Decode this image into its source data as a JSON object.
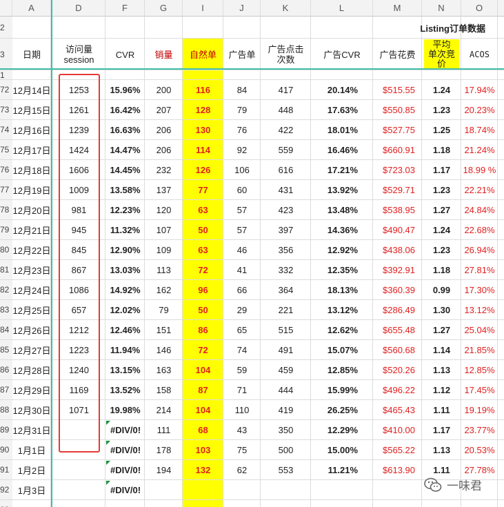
{
  "column_letters": [
    "A",
    "D",
    "F",
    "G",
    "I",
    "J",
    "K",
    "L",
    "M",
    "N",
    "O"
  ],
  "header_row_numbers": {
    "title_row": "2",
    "header_row": "3",
    "partial_top_row": "1"
  },
  "title": "Listing订单数据",
  "headers": {
    "date": "日期",
    "sessions_l1": "访问量",
    "sessions_l2": "session",
    "cvr": "CVR",
    "sales": "销量",
    "organic": "自然单",
    "ad_orders": "广告单",
    "ad_clicks_l1": "广告点击",
    "ad_clicks_l2": "次数",
    "ad_cvr": "广告CVR",
    "ad_spend": "广告花费",
    "avg_bid_l1": "平均",
    "avg_bid_l2": "单次竞",
    "avg_bid_l3": "价",
    "acos": "ACOS"
  },
  "rows": [
    {
      "rn": "72",
      "date": "12月14日",
      "sessions": "1253",
      "cvr": "15.96%",
      "sales": "200",
      "organic": "116",
      "ad_orders": "84",
      "ad_clicks": "417",
      "ad_cvr": "20.14%",
      "ad_spend": "$515.55",
      "avg_bid": "1.24",
      "acos": "17.94%"
    },
    {
      "rn": "73",
      "date": "12月15日",
      "sessions": "1261",
      "cvr": "16.42%",
      "sales": "207",
      "organic": "128",
      "ad_orders": "79",
      "ad_clicks": "448",
      "ad_cvr": "17.63%",
      "ad_spend": "$550.85",
      "avg_bid": "1.23",
      "acos": "20.23%"
    },
    {
      "rn": "74",
      "date": "12月16日",
      "sessions": "1239",
      "cvr": "16.63%",
      "sales": "206",
      "organic": "130",
      "ad_orders": "76",
      "ad_clicks": "422",
      "ad_cvr": "18.01%",
      "ad_spend": "$527.75",
      "avg_bid": "1.25",
      "acos": "18.74%"
    },
    {
      "rn": "75",
      "date": "12月17日",
      "sessions": "1424",
      "cvr": "14.47%",
      "sales": "206",
      "organic": "114",
      "ad_orders": "92",
      "ad_clicks": "559",
      "ad_cvr": "16.46%",
      "ad_spend": "$660.91",
      "avg_bid": "1.18",
      "acos": "21.24%"
    },
    {
      "rn": "76",
      "date": "12月18日",
      "sessions": "1606",
      "cvr": "14.45%",
      "sales": "232",
      "organic": "126",
      "ad_orders": "106",
      "ad_clicks": "616",
      "ad_cvr": "17.21%",
      "ad_spend": "$723.03",
      "avg_bid": "1.17",
      "acos": "18.99 %"
    },
    {
      "rn": "77",
      "date": "12月19日",
      "sessions": "1009",
      "cvr": "13.58%",
      "sales": "137",
      "organic": "77",
      "ad_orders": "60",
      "ad_clicks": "431",
      "ad_cvr": "13.92%",
      "ad_spend": "$529.71",
      "avg_bid": "1.23",
      "acos": "22.21%"
    },
    {
      "rn": "78",
      "date": "12月20日",
      "sessions": "981",
      "cvr": "12.23%",
      "sales": "120",
      "organic": "63",
      "ad_orders": "57",
      "ad_clicks": "423",
      "ad_cvr": "13.48%",
      "ad_spend": "$538.95",
      "avg_bid": "1.27",
      "acos": "24.84%"
    },
    {
      "rn": "79",
      "date": "12月21日",
      "sessions": "945",
      "cvr": "11.32%",
      "sales": "107",
      "organic": "50",
      "ad_orders": "57",
      "ad_clicks": "397",
      "ad_cvr": "14.36%",
      "ad_spend": "$490.47",
      "avg_bid": "1.24",
      "acos": "22.68%"
    },
    {
      "rn": "80",
      "date": "12月22日",
      "sessions": "845",
      "cvr": "12.90%",
      "sales": "109",
      "organic": "63",
      "ad_orders": "46",
      "ad_clicks": "356",
      "ad_cvr": "12.92%",
      "ad_spend": "$438.06",
      "avg_bid": "1.23",
      "acos": "26.94%"
    },
    {
      "rn": "81",
      "date": "12月23日",
      "sessions": "867",
      "cvr": "13.03%",
      "sales": "113",
      "organic": "72",
      "ad_orders": "41",
      "ad_clicks": "332",
      "ad_cvr": "12.35%",
      "ad_spend": "$392.91",
      "avg_bid": "1.18",
      "acos": "27.81%"
    },
    {
      "rn": "82",
      "date": "12月24日",
      "sessions": "1086",
      "cvr": "14.92%",
      "sales": "162",
      "organic": "96",
      "ad_orders": "66",
      "ad_clicks": "364",
      "ad_cvr": "18.13%",
      "ad_spend": "$360.39",
      "avg_bid": "0.99",
      "acos": "17.30%"
    },
    {
      "rn": "83",
      "date": "12月25日",
      "sessions": "657",
      "cvr": "12.02%",
      "sales": "79",
      "organic": "50",
      "ad_orders": "29",
      "ad_clicks": "221",
      "ad_cvr": "13.12%",
      "ad_spend": "$286.49",
      "avg_bid": "1.30",
      "acos": "13.12%"
    },
    {
      "rn": "84",
      "date": "12月26日",
      "sessions": "1212",
      "cvr": "12.46%",
      "sales": "151",
      "organic": "86",
      "ad_orders": "65",
      "ad_clicks": "515",
      "ad_cvr": "12.62%",
      "ad_spend": "$655.48",
      "avg_bid": "1.27",
      "acos": "25.04%"
    },
    {
      "rn": "85",
      "date": "12月27日",
      "sessions": "1223",
      "cvr": "11.94%",
      "sales": "146",
      "organic": "72",
      "ad_orders": "74",
      "ad_clicks": "491",
      "ad_cvr": "15.07%",
      "ad_spend": "$560.68",
      "avg_bid": "1.14",
      "acos": "21.85%"
    },
    {
      "rn": "86",
      "date": "12月28日",
      "sessions": "1240",
      "cvr": "13.15%",
      "sales": "163",
      "organic": "104",
      "ad_orders": "59",
      "ad_clicks": "459",
      "ad_cvr": "12.85%",
      "ad_spend": "$520.26",
      "avg_bid": "1.13",
      "acos": "12.85%"
    },
    {
      "rn": "87",
      "date": "12月29日",
      "sessions": "1169",
      "cvr": "13.52%",
      "sales": "158",
      "organic": "87",
      "ad_orders": "71",
      "ad_clicks": "444",
      "ad_cvr": "15.99%",
      "ad_spend": "$496.22",
      "avg_bid": "1.12",
      "acos": "17.45%"
    },
    {
      "rn": "88",
      "date": "12月30日",
      "sessions": "1071",
      "cvr": "19.98%",
      "sales": "214",
      "organic": "104",
      "ad_orders": "110",
      "ad_clicks": "419",
      "ad_cvr": "26.25%",
      "ad_spend": "$465.43",
      "avg_bid": "1.11",
      "acos": "19.19%"
    },
    {
      "rn": "89",
      "date": "12月31日",
      "sessions": "",
      "cvr": "#DIV/0!",
      "sales": "111",
      "organic": "68",
      "ad_orders": "43",
      "ad_clicks": "350",
      "ad_cvr": "12.29%",
      "ad_spend": "$410.00",
      "avg_bid": "1.17",
      "acos": "23.77%"
    },
    {
      "rn": "90",
      "date": "1月1日",
      "sessions": "",
      "cvr": "#DIV/0!",
      "sales": "178",
      "organic": "103",
      "ad_orders": "75",
      "ad_clicks": "500",
      "ad_cvr": "15.00%",
      "ad_spend": "$565.22",
      "avg_bid": "1.13",
      "acos": "20.53%"
    },
    {
      "rn": "91",
      "date": "1月2日",
      "sessions": "",
      "cvr": "#DIV/0!",
      "sales": "194",
      "organic": "132",
      "ad_orders": "62",
      "ad_clicks": "553",
      "ad_cvr": "11.21%",
      "ad_spend": "$613.90",
      "avg_bid": "1.11",
      "acos": "27.78%"
    },
    {
      "rn": "92",
      "date": "1月3日",
      "sessions": "",
      "cvr": "#DIV/0!",
      "sales": "",
      "organic": "",
      "ad_orders": "",
      "ad_clicks": "",
      "ad_cvr": "",
      "ad_spend": "",
      "avg_bid": "",
      "acos": ""
    },
    {
      "rn": "93",
      "date": "",
      "sessions": "",
      "cvr": "",
      "sales": "",
      "organic": "",
      "ad_orders": "",
      "ad_clicks": "",
      "ad_cvr": "",
      "ad_spend": "",
      "avg_bid": "",
      "acos": ""
    }
  ],
  "watermark": "一味君",
  "colors": {
    "highlight": "#ffff00",
    "freeze_line": "#3fbfa8",
    "red_text": "#e02020",
    "annotation_box": "#e53935",
    "error_flag": "#1a8f3c"
  }
}
